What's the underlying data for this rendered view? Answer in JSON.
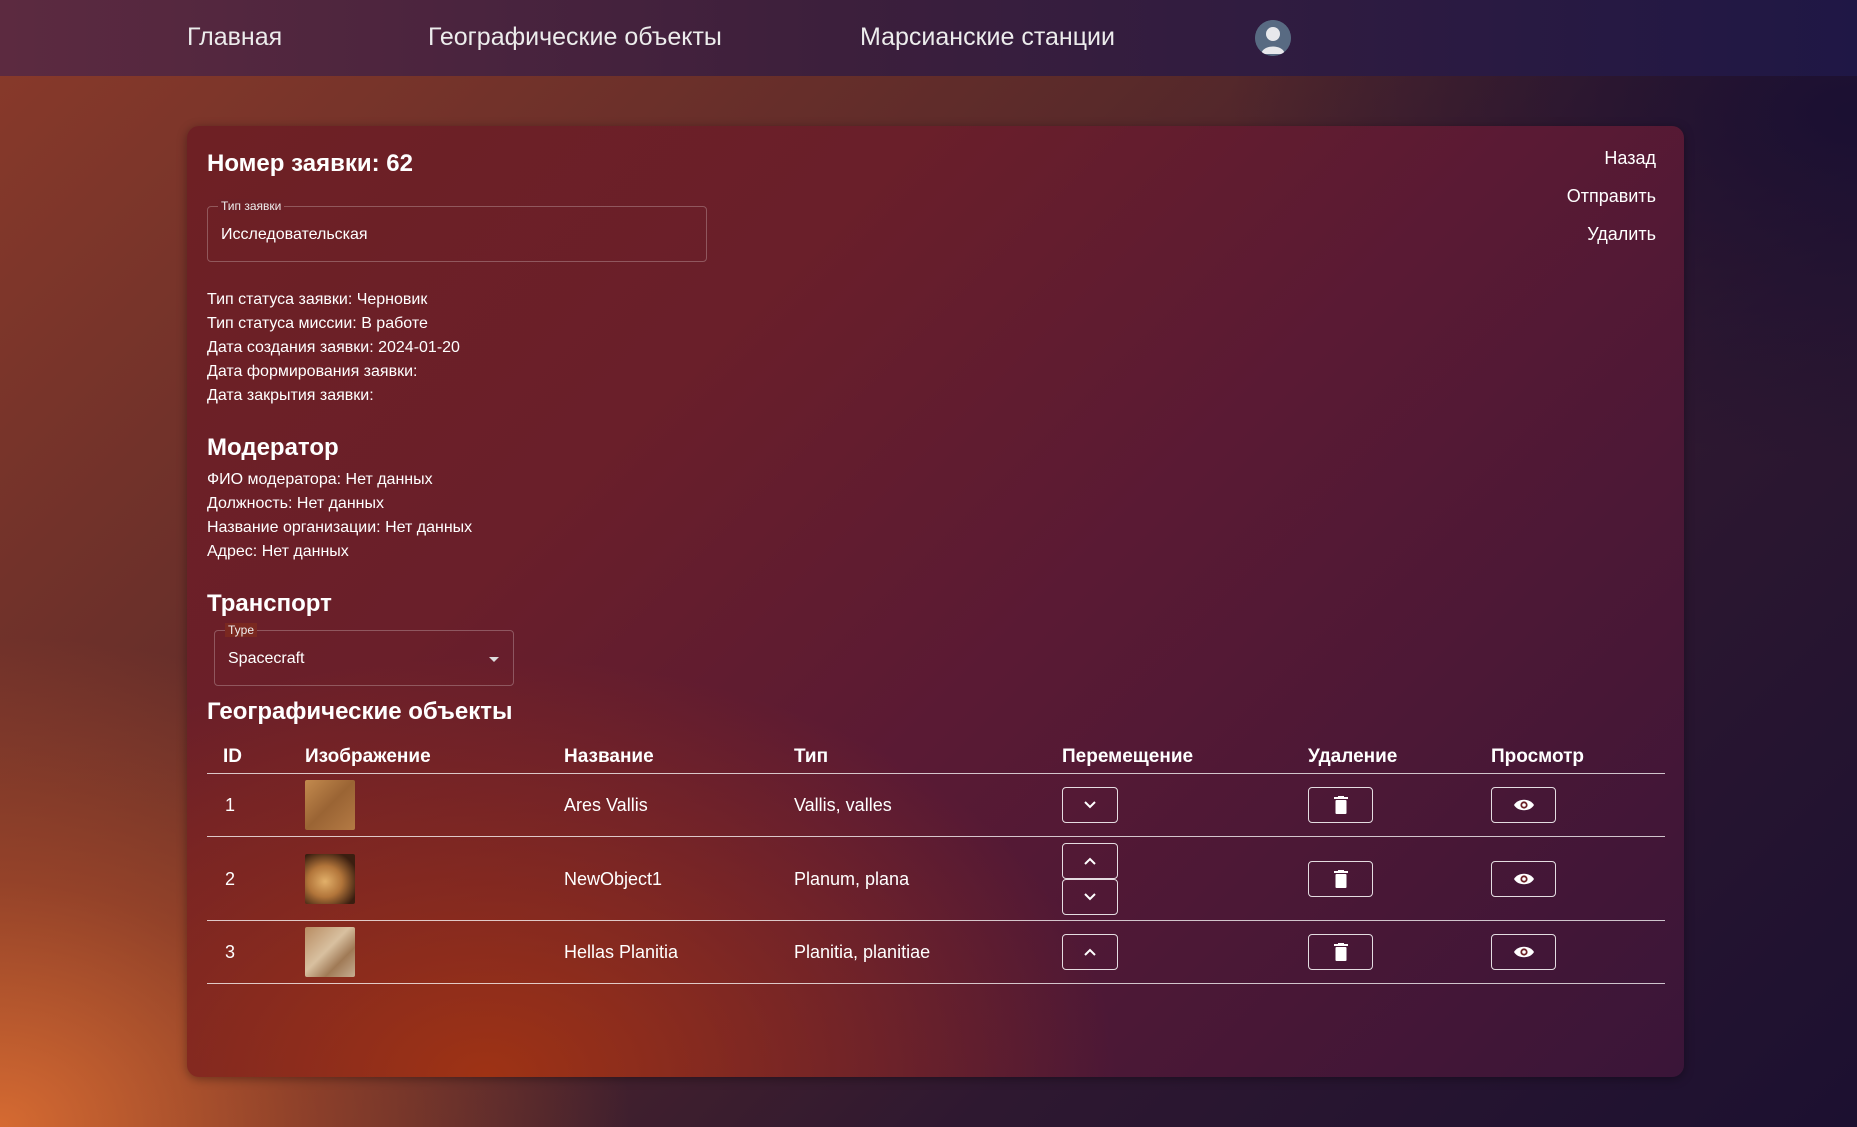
{
  "nav": {
    "home": "Главная",
    "geo_objects": "Географические объекты",
    "stations": "Марсианские станции",
    "avatar_icon": "user-avatar-icon"
  },
  "request": {
    "title": "Номер заявки: 62",
    "type_field": {
      "label": "Тип заявки",
      "value": "Исследовательская"
    },
    "info": [
      "Тип статуса заявки: Черновик",
      "Тип статуса миссии: В работе",
      "Дата создания заявки: 2024-01-20",
      "Дата формирования заявки:",
      "Дата закрытия заявки:"
    ]
  },
  "actions": {
    "back": "Назад",
    "send": "Отправить",
    "delete": "Удалить"
  },
  "moderator": {
    "heading": "Модератор",
    "lines": [
      "ФИО модератора: Нет данных",
      "Должность: Нет данных",
      "Название организации: Нет данных",
      "Адрес: Нет данных"
    ]
  },
  "transport": {
    "heading": "Транспорт",
    "select": {
      "label": "Type",
      "value": "Spacecraft"
    }
  },
  "geo": {
    "heading": "Географические объекты",
    "columns": [
      "ID",
      "Изображение",
      "Название",
      "Тип",
      "Перемещение",
      "Удаление",
      "Просмотр"
    ],
    "rows": [
      {
        "id": "1",
        "name": "Ares Vallis",
        "type": "Vallis, valles"
      },
      {
        "id": "2",
        "name": "NewObject1",
        "type": "Planum, plana"
      },
      {
        "id": "3",
        "name": "Hellas Planitia",
        "type": "Planitia, planitiae"
      }
    ]
  },
  "colors": {
    "border": "#ffffff",
    "nav_start": "#5c2a40",
    "nav_end": "#1f1745"
  }
}
